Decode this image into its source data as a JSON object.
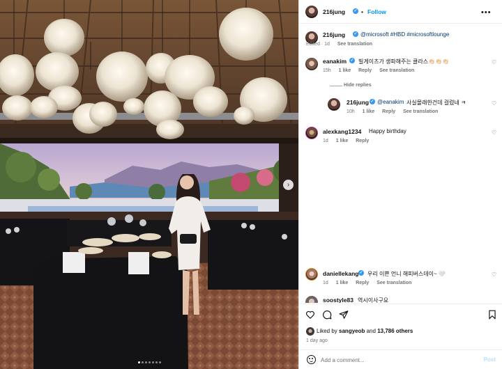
{
  "post": {
    "username": "216jung",
    "separator": "•",
    "follow_label": "Follow",
    "more_label": "•••"
  },
  "caption": {
    "username": "216jung",
    "text_prefix": "@microsoft #HBD #microsoftlounge",
    "edited": "Edited · 1d",
    "translation": "See translation"
  },
  "comments": [
    {
      "username": "eanakim",
      "text": "빌게이츠가 생파해주는 클라스👏🏻👏🏻👏🏻",
      "time": "15h",
      "likes": "1 like",
      "reply": "Reply",
      "translation": "See translation"
    },
    {
      "hide_replies": "Hide replies",
      "username": "216jung",
      "mention": "@eanakim",
      "text": "사실몰래한건데 걸렸네 ㅋ",
      "time": "10h",
      "likes": "1 like",
      "reply": "Reply",
      "translation": "See translation"
    },
    {
      "username": "alexkang1234",
      "text": "Happy birthday",
      "time": "1d",
      "likes": "1 like",
      "reply": "Reply"
    },
    {
      "username": "daniellekang",
      "text": "우리 이쁜 언니 해피버스데이~ 🤍",
      "time": "1d",
      "likes": "1 like",
      "reply": "Reply",
      "translation": "See translation"
    },
    {
      "username": "soostyle83",
      "text": "역시이사구요"
    }
  ],
  "likes": {
    "prefix": "Liked by",
    "user": "sangyeob",
    "and": "and",
    "others": "13,786 others"
  },
  "post_time": "1 day ago",
  "add_comment": {
    "placeholder": "Add a comment...",
    "post_label": "Post"
  },
  "carousel": {
    "slides": 7,
    "active": 0
  },
  "icons": {
    "like": "heart-icon",
    "comment": "comment-icon",
    "share": "share-icon",
    "save": "bookmark-icon",
    "emoji": "emoji-icon",
    "next": "chevron-right-icon"
  },
  "colors": {
    "link": "#00376b",
    "follow": "#0095f6",
    "verified": "#3897f0",
    "muted": "#737373"
  }
}
